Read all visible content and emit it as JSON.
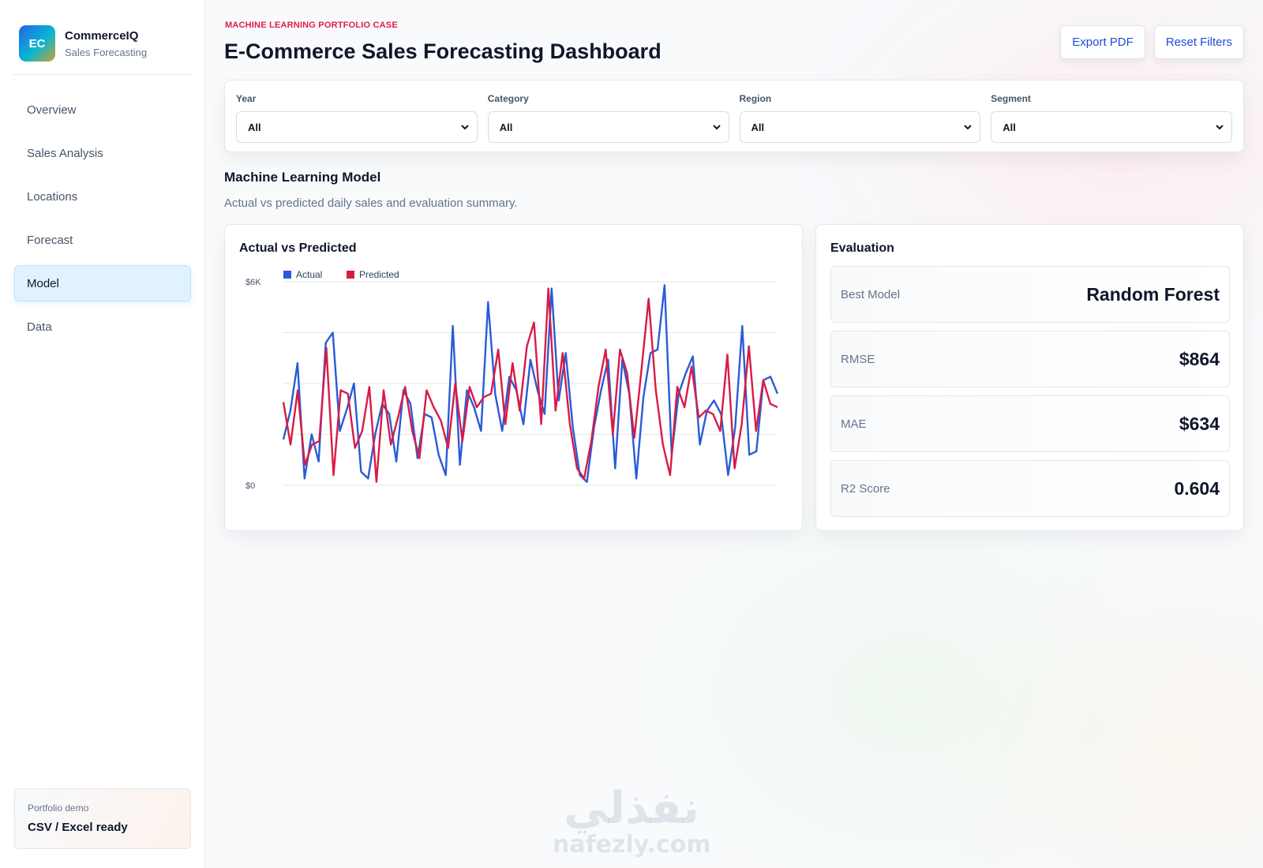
{
  "brand": {
    "logo": "EC",
    "name": "CommerceIQ",
    "subtitle": "Sales Forecasting"
  },
  "nav": {
    "items": [
      {
        "label": "Overview",
        "active": false
      },
      {
        "label": "Sales Analysis",
        "active": false
      },
      {
        "label": "Locations",
        "active": false
      },
      {
        "label": "Forecast",
        "active": false
      },
      {
        "label": "Model",
        "active": true
      },
      {
        "label": "Data",
        "active": false
      }
    ]
  },
  "demo": {
    "label": "Portfolio demo",
    "value": "CSV / Excel ready"
  },
  "header": {
    "eyebrow": "MACHINE LEARNING PORTFOLIO CASE",
    "title": "E-Commerce Sales Forecasting Dashboard",
    "export_label": "Export PDF",
    "reset_label": "Reset Filters"
  },
  "filters": [
    {
      "label": "Year",
      "value": "All"
    },
    {
      "label": "Category",
      "value": "All"
    },
    {
      "label": "Region",
      "value": "All"
    },
    {
      "label": "Segment",
      "value": "All"
    }
  ],
  "section": {
    "title": "Machine Learning Model",
    "subtitle": "Actual vs predicted daily sales and evaluation summary."
  },
  "chart_card_title": "Actual vs Predicted",
  "evaluation": {
    "title": "Evaluation",
    "metrics": [
      {
        "label": "Best Model",
        "value": "Random Forest"
      },
      {
        "label": "RMSE",
        "value": "$864"
      },
      {
        "label": "MAE",
        "value": "$634"
      },
      {
        "label": "R2 Score",
        "value": "0.604"
      }
    ]
  },
  "colors": {
    "actual": "#2a5bd7",
    "predicted": "#d81b45",
    "accent": "#e11d48",
    "active_nav": "#e0f2fe"
  },
  "chart_data": {
    "type": "line",
    "title": "Actual vs Predicted",
    "xlabel": "",
    "ylabel": "",
    "ylim": [
      0,
      6000
    ],
    "y_ticks": [
      "$0",
      "$6K"
    ],
    "legend_position": "top-left",
    "grid": true,
    "series": [
      {
        "name": "Actual",
        "color": "#2a5bd7",
        "values": [
          1350,
          2200,
          3600,
          200,
          1500,
          700,
          4200,
          4500,
          1600,
          2250,
          3000,
          400,
          200,
          1500,
          2400,
          2100,
          700,
          2800,
          2400,
          800,
          2100,
          2000,
          900,
          300,
          4700,
          600,
          2800,
          2300,
          1600,
          5400,
          2700,
          1600,
          3200,
          2800,
          1800,
          3700,
          2800,
          2100,
          5800,
          2500,
          3900,
          1700,
          300,
          100,
          1700,
          2800,
          3700,
          500,
          3700,
          2700,
          200,
          2600,
          3900,
          4000,
          5900,
          900,
          2700,
          3300,
          3800,
          1200,
          2200,
          2500,
          2100,
          300,
          1700,
          4700,
          900,
          1000,
          3100,
          3200,
          2700
        ]
      },
      {
        "name": "Predicted",
        "color": "#d81b45",
        "values": [
          2450,
          1200,
          2800,
          600,
          1200,
          1300,
          4050,
          300,
          2800,
          2700,
          1100,
          1600,
          2900,
          100,
          2800,
          1200,
          2000,
          2900,
          1600,
          800,
          2800,
          2300,
          1900,
          1100,
          3000,
          1300,
          2900,
          2300,
          2600,
          2700,
          4000,
          1800,
          3600,
          2200,
          4100,
          4800,
          1800,
          5800,
          2200,
          3900,
          1800,
          500,
          200,
          1300,
          2900,
          4000,
          1500,
          4000,
          3300,
          1400,
          3400,
          5500,
          2800,
          1200,
          300,
          2900,
          2300,
          3500,
          2000,
          2200,
          2100,
          1600,
          3850,
          500,
          1800,
          4100,
          1600,
          3100,
          2400,
          2300
        ]
      }
    ]
  }
}
